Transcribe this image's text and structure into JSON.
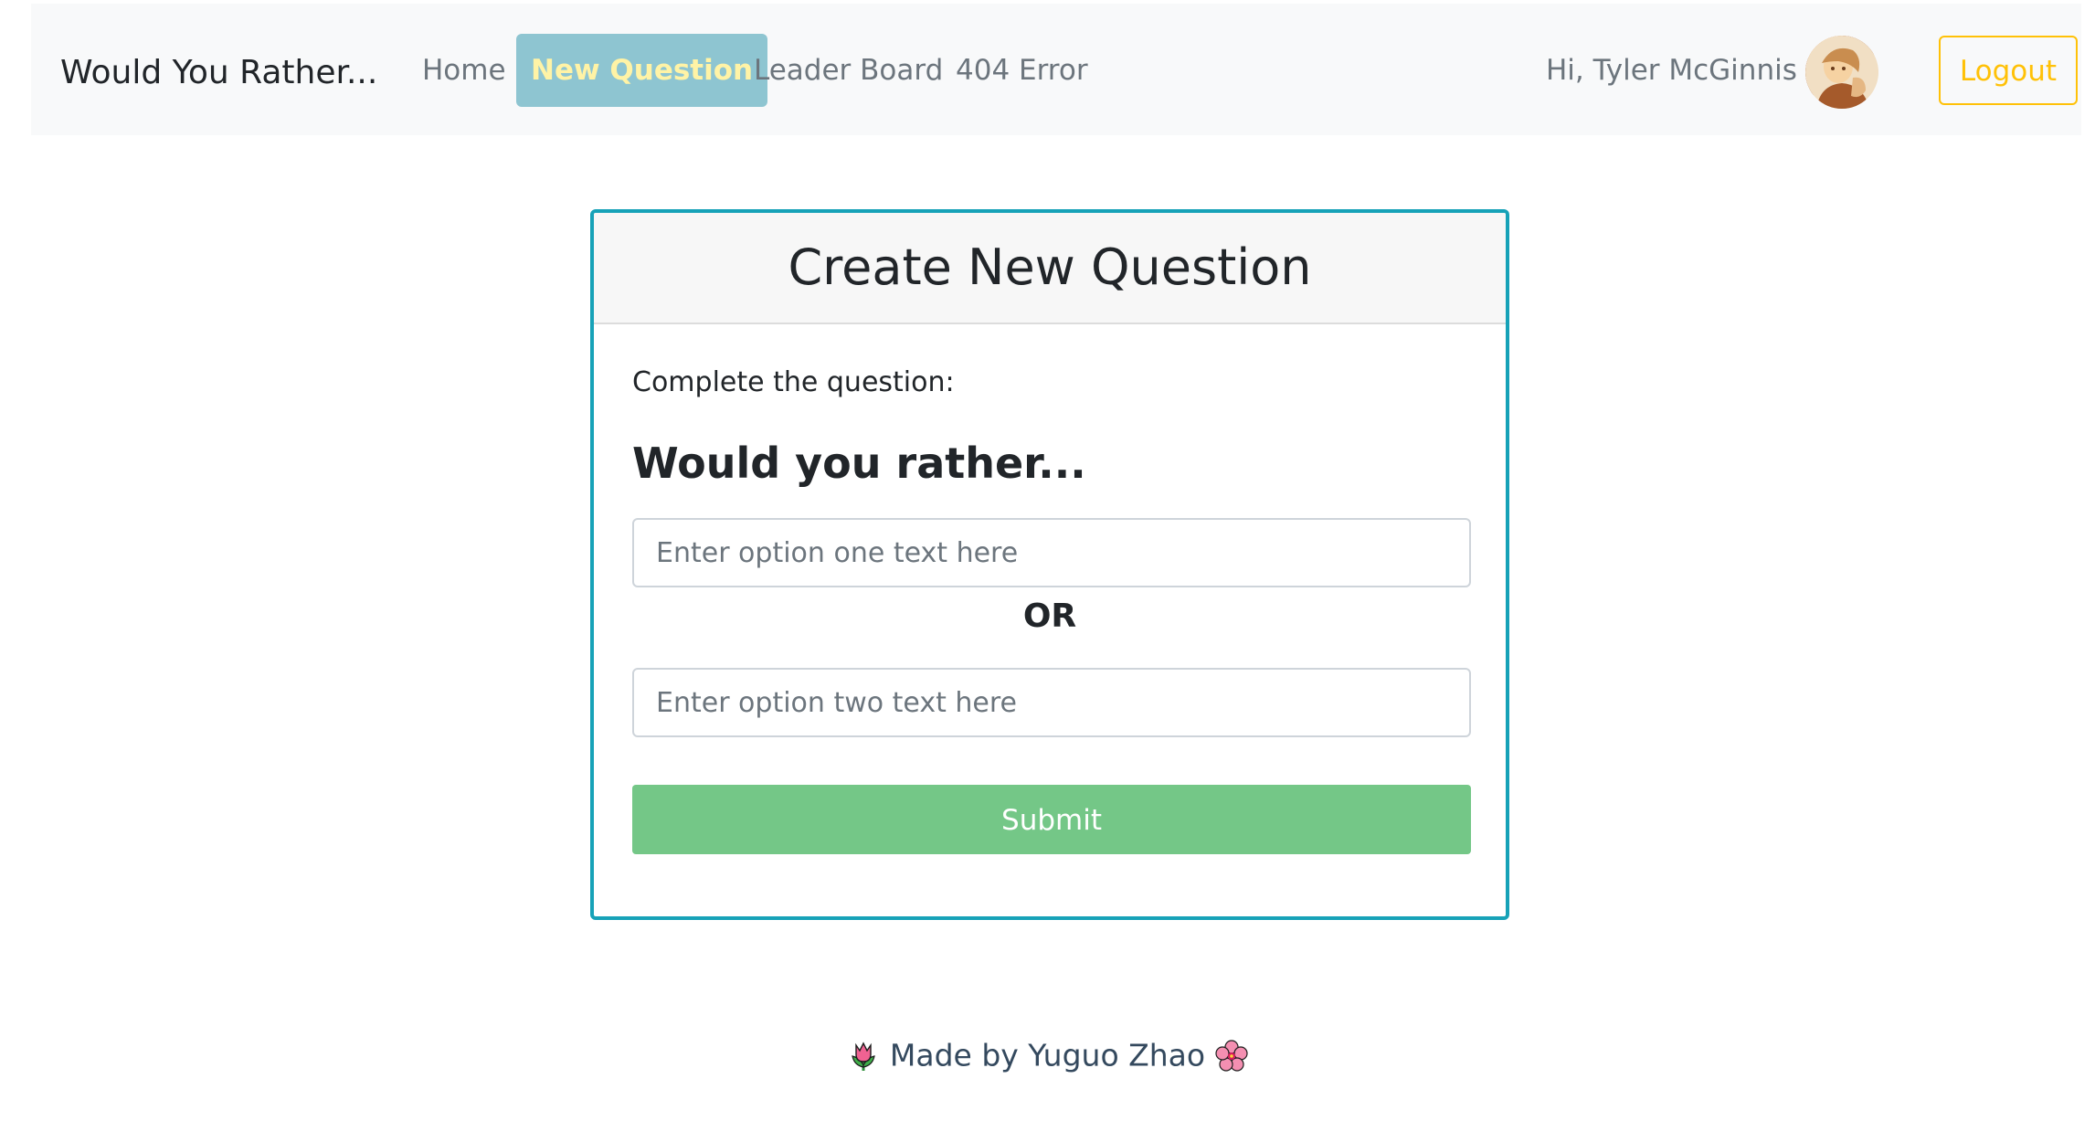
{
  "navbar": {
    "brand": "Would You Rather...",
    "links": [
      {
        "label": "Home",
        "active": false
      },
      {
        "label": "New Question",
        "active": true
      },
      {
        "label": "Leader Board",
        "active": false
      },
      {
        "label": "404 Error",
        "active": false
      }
    ],
    "greeting": "Hi, Tyler McGinnis",
    "avatar_icon": "user-avatar",
    "logout_label": "Logout"
  },
  "card": {
    "title": "Create New Question",
    "instruction": "Complete the question:",
    "subtitle": "Would you rather...",
    "option_one_placeholder": "Enter option one text here",
    "option_one_value": "",
    "or_label": "OR",
    "option_two_placeholder": "Enter option two text here",
    "option_two_value": "",
    "submit_label": "Submit"
  },
  "footer": {
    "left_icon": "tulip-icon",
    "text": "Made by Yuguo Zhao",
    "right_icon": "hibiscus-icon"
  },
  "colors": {
    "active_nav_bg": "#8ec5d1",
    "active_nav_text": "#fff3a6",
    "card_border": "#17a2b8",
    "logout_outline": "#ffc107",
    "submit_bg": "#74c787",
    "footer_text": "#34495e"
  }
}
